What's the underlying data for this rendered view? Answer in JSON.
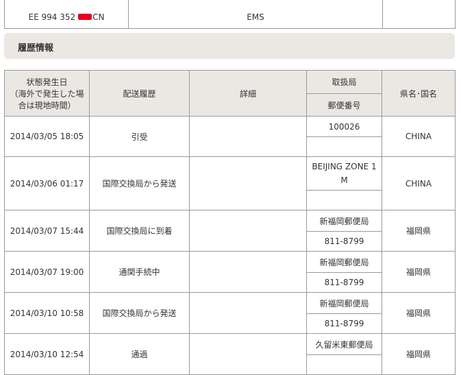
{
  "tracking": {
    "number_prefix": "EE 994 352",
    "number_suffix": "CN",
    "service": "EMS"
  },
  "section": {
    "title": "履歴情報"
  },
  "table": {
    "headers": {
      "date_line1": "状態発生日",
      "date_line2": "（海外で発生した場",
      "date_line3": "合は現地時間）",
      "history": "配送履歴",
      "detail": "詳細",
      "office": "取扱局",
      "postal": "郵便番号",
      "region": "県名･国名"
    },
    "rows": [
      {
        "date": "2014/03/05 18:05",
        "history": "引受",
        "detail": "",
        "office": "100026",
        "postal": "",
        "region": "CHINA"
      },
      {
        "date": "2014/03/06 01:17",
        "history": "国際交換局から発送",
        "detail": "",
        "office_line1": "BEIJING ZONE 1",
        "office_line2": "M",
        "postal": "",
        "region": "CHINA"
      },
      {
        "date": "2014/03/07 15:44",
        "history": "国際交換局に到着",
        "detail": "",
        "office": "新福岡郵便局",
        "postal": "811-8799",
        "region": "福岡県"
      },
      {
        "date": "2014/03/07 19:00",
        "history": "通関手続中",
        "detail": "",
        "office": "新福岡郵便局",
        "postal": "811-8799",
        "region": "福岡県"
      },
      {
        "date": "2014/03/10 10:58",
        "history": "国際交換局から発送",
        "detail": "",
        "office": "新福岡郵便局",
        "postal": "811-8799",
        "region": "福岡県"
      },
      {
        "date": "2014/03/10 12:54",
        "history": "通過",
        "detail": "",
        "office": "久留米東郵便局",
        "postal": "",
        "region": "福岡県"
      }
    ]
  }
}
